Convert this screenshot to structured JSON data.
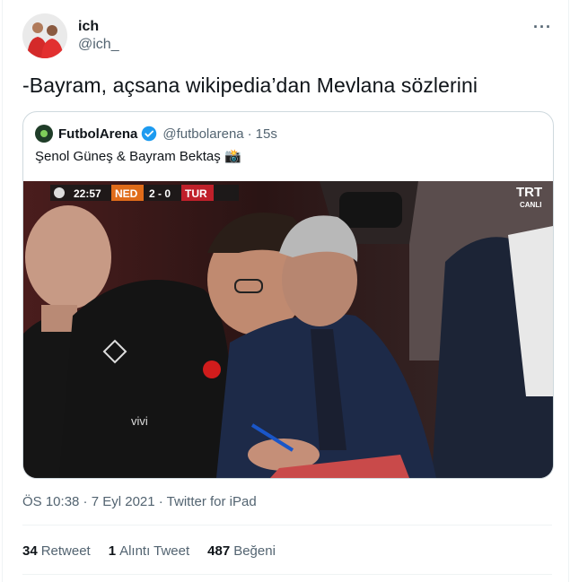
{
  "author": {
    "name": "ich",
    "handle": "@ich_"
  },
  "menu": {
    "icon": "more-dots-icon",
    "label": "···"
  },
  "tweet": {
    "text": "-Bayram, açsana wikipedia’dan Mevlana sözlerini"
  },
  "quoted": {
    "name": "FutbolArena",
    "handle": "@futbolarena",
    "separator": "·",
    "time": "15s",
    "text": "Şenol Güneş & Bayram Bektaş 📸",
    "media": {
      "scoreboard": {
        "clock": "22:57",
        "home": "NED",
        "score": "2 - 0",
        "away": "TUR"
      },
      "channel": {
        "logo": "TRT",
        "sub": "CANLI"
      },
      "shirt_text": "vivi"
    }
  },
  "timestamp": "ÖS 10:38 · 7 Eyl 2021 · Twitter for iPad",
  "stats": [
    {
      "count": "34",
      "label": "Retweet"
    },
    {
      "count": "1",
      "label": "Alıntı Tweet"
    },
    {
      "count": "487",
      "label": "Beğeni"
    }
  ],
  "colors": {
    "text": "#0f1419",
    "secondary": "#536471",
    "verified": "#1d9bf0",
    "border": "#cfd9de"
  }
}
